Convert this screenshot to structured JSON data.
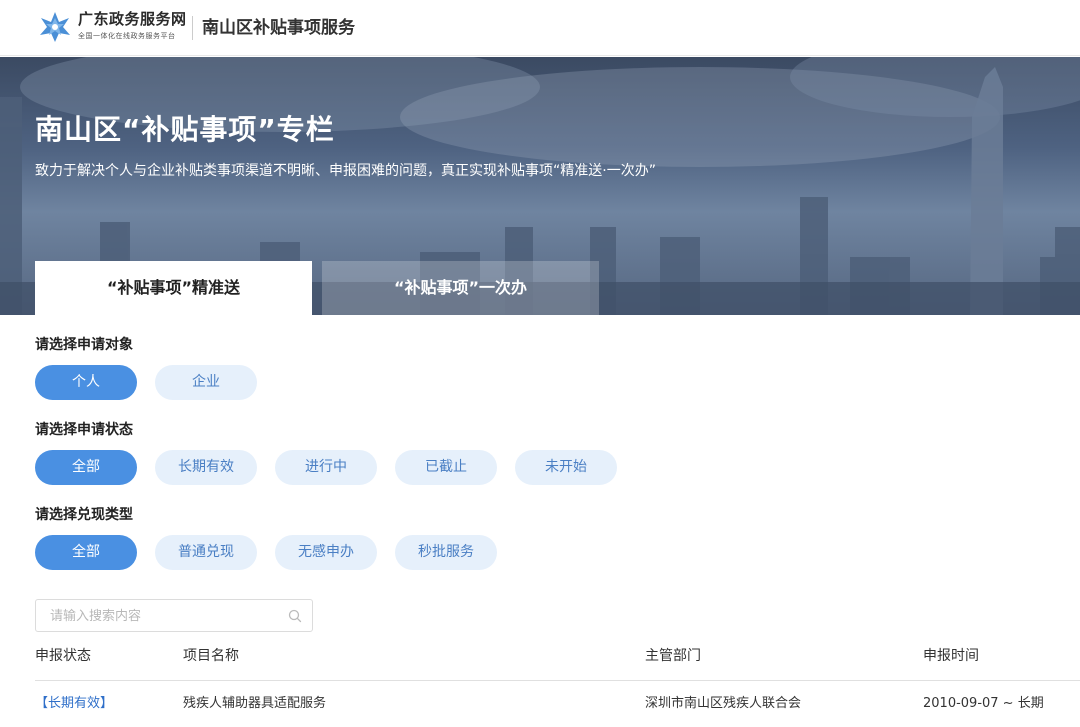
{
  "header": {
    "brand_name": "广东政务服务网",
    "brand_sub": "全国一体化在线政务服务平台",
    "site_title": "南山区补贴事项服务"
  },
  "banner": {
    "title": "南山区“补贴事项”专栏",
    "description": "致力于解决个人与企业补贴类事项渠道不明晰、申报困难的问题，真正实现补贴事项“精准送·一次办”"
  },
  "tabs": [
    {
      "label": "“补贴事项”精准送",
      "active": true
    },
    {
      "label": "“补贴事项”一次办",
      "active": false
    }
  ],
  "filters": {
    "target": {
      "label": "请选择申请对象",
      "options": [
        "个人",
        "企业"
      ],
      "selected": "个人"
    },
    "status": {
      "label": "请选择申请状态",
      "options": [
        "全部",
        "长期有效",
        "进行中",
        "已截止",
        "未开始"
      ],
      "selected": "全部"
    },
    "type": {
      "label": "请选择兑现类型",
      "options": [
        "全部",
        "普通兑现",
        "无感申办",
        "秒批服务"
      ],
      "selected": "全部"
    }
  },
  "search": {
    "placeholder": "请输入搜索内容",
    "value": "",
    "icon": "search-icon"
  },
  "table": {
    "columns": [
      "申报状态",
      "项目名称",
      "主管部门",
      "申报时间"
    ],
    "rows": [
      {
        "status": "【长期有效】",
        "name": "残疾人辅助器具适配服务",
        "department": "深圳市南山区残疾人联合会",
        "time": "2010-09-07 ~ 长期"
      }
    ]
  },
  "colors": {
    "accent": "#4a90e2",
    "pill_inactive_bg": "#e6f0fb",
    "pill_inactive_text": "#4a7fc4",
    "status_link": "#2f6fc9"
  }
}
